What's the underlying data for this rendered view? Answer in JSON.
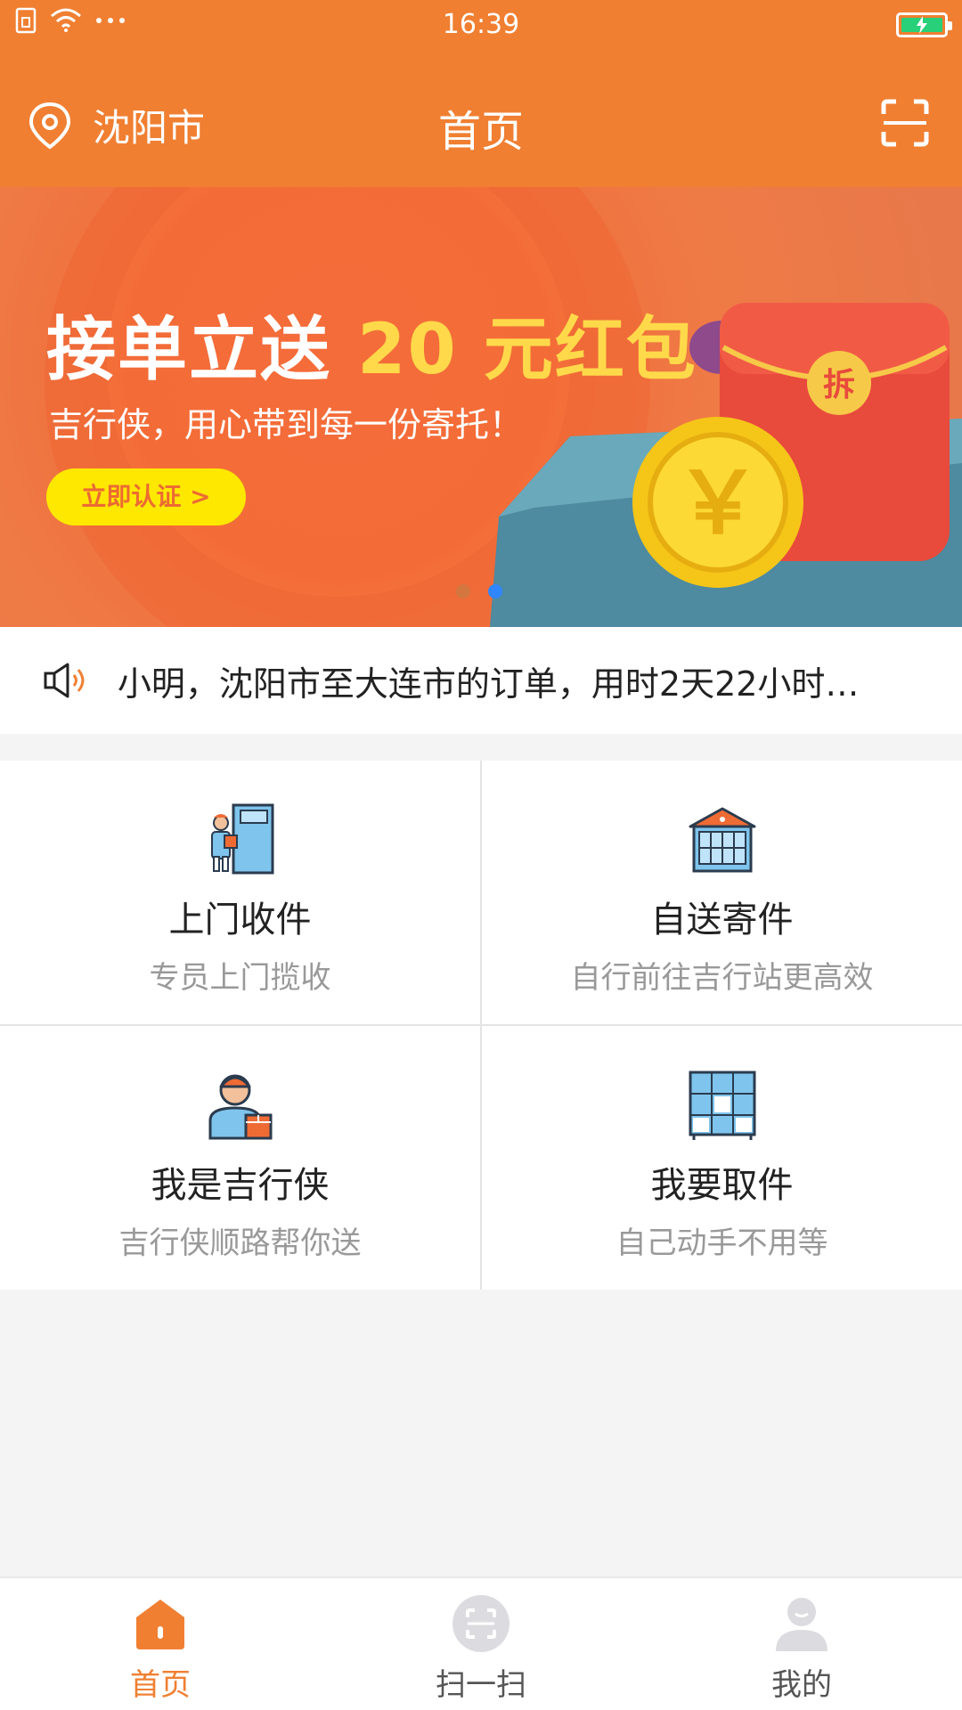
{
  "status_bar": {
    "time": "16:39",
    "icons": [
      "sim-icon",
      "wifi-icon",
      "more-dots-icon",
      "battery-charging-icon"
    ]
  },
  "header": {
    "city": "沈阳市",
    "title": "首页",
    "location_icon": "location-pin-icon",
    "scan_icon": "scan-icon"
  },
  "banner": {
    "headline_white": "接单立送",
    "headline_yellow": "20 元红包",
    "subtitle": "吉行侠，用心带到每一份寄托！",
    "cta_label": "立即认证 >",
    "red_envelope_char": "拆",
    "coin_char": "￥",
    "slide_count": 2,
    "active_slide": 2
  },
  "notice": {
    "icon": "speaker-icon",
    "text": "小明，沈阳市至大连市的订单，用时2天22小时…"
  },
  "services": [
    {
      "title": "上门收件",
      "subtitle": "专员上门揽收",
      "icon": "courier-door-icon"
    },
    {
      "title": "自送寄件",
      "subtitle": "自行前往吉行站更高效",
      "icon": "station-building-icon"
    },
    {
      "title": "我是吉行侠",
      "subtitle": "吉行侠顺路帮你送",
      "icon": "courier-person-icon"
    },
    {
      "title": "我要取件",
      "subtitle": "自己动手不用等",
      "icon": "locker-icon"
    }
  ],
  "tabbar": {
    "items": [
      {
        "label": "首页",
        "icon": "home-icon",
        "active": true
      },
      {
        "label": "扫一扫",
        "icon": "scan-tab-icon",
        "active": false
      },
      {
        "label": "我的",
        "icon": "profile-icon",
        "active": false
      }
    ]
  },
  "colors": {
    "brand_orange": "#f07f32",
    "accent_yellow": "#ffd94a",
    "cta_yellow": "#ffe800",
    "dot_active": "#2f86ff",
    "battery_green": "#28d079"
  }
}
